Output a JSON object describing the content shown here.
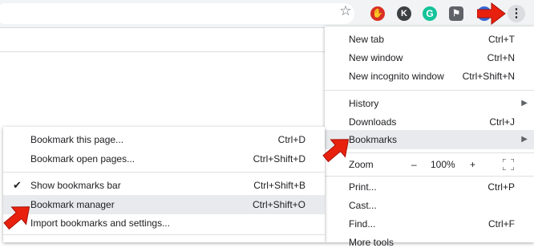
{
  "toolbar": {
    "icons": [
      "star-icon",
      "adblock-extension-icon",
      "k-extension-icon",
      "grammarly-extension-icon",
      "puzzle-extension-icon",
      "profile-icon",
      "more-menu-icon"
    ],
    "ext_letters": {
      "k": "K",
      "grammarly": "G"
    }
  },
  "menu": {
    "new_tab": {
      "label": "New tab",
      "shortcut": "Ctrl+T"
    },
    "new_window": {
      "label": "New window",
      "shortcut": "Ctrl+N"
    },
    "incognito": {
      "label": "New incognito window",
      "shortcut": "Ctrl+Shift+N"
    },
    "history": {
      "label": "History"
    },
    "downloads": {
      "label": "Downloads",
      "shortcut": "Ctrl+J"
    },
    "bookmarks": {
      "label": "Bookmarks"
    },
    "zoom": {
      "label": "Zoom",
      "minus": "–",
      "value": "100%",
      "plus": "+"
    },
    "print": {
      "label": "Print...",
      "shortcut": "Ctrl+P"
    },
    "cast": {
      "label": "Cast..."
    },
    "find": {
      "label": "Find...",
      "shortcut": "Ctrl+F"
    },
    "more_tools": {
      "label": "More tools"
    }
  },
  "bookmarks_submenu": {
    "bookmark_page": {
      "label": "Bookmark this page...",
      "shortcut": "Ctrl+D"
    },
    "bookmark_open": {
      "label": "Bookmark open pages...",
      "shortcut": "Ctrl+Shift+D"
    },
    "show_bar": {
      "label": "Show bookmarks bar",
      "shortcut": "Ctrl+Shift+B",
      "checked": true
    },
    "manager": {
      "label": "Bookmark manager",
      "shortcut": "Ctrl+Shift+O"
    },
    "import": {
      "label": "Import bookmarks and settings..."
    }
  },
  "colors": {
    "arrow": "#e8210f",
    "highlight": "#e8eaed",
    "toolbar": "#f1f3f4"
  }
}
